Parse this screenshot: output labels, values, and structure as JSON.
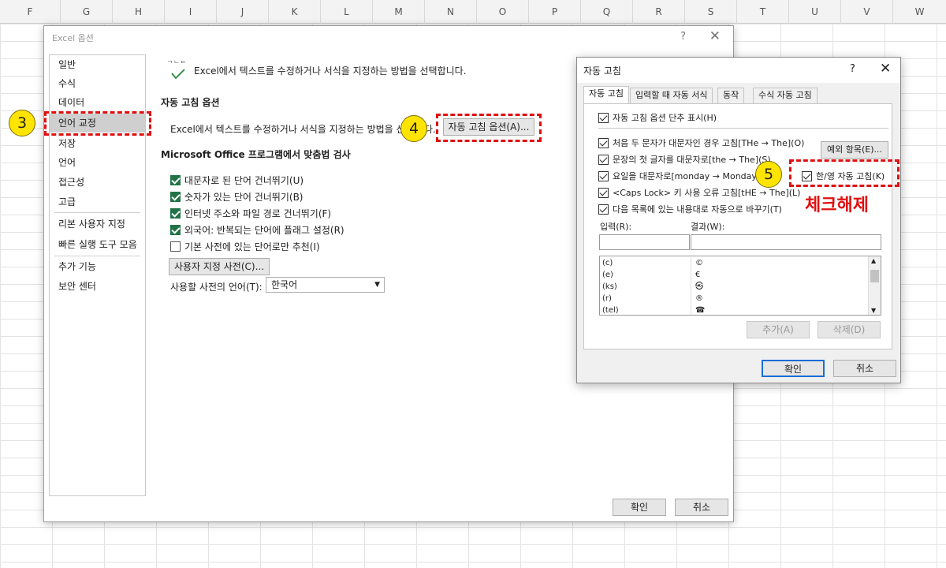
{
  "sheet": {
    "columns": [
      "F",
      "G",
      "H",
      "I",
      "J",
      "K",
      "L",
      "M",
      "N",
      "O",
      "P",
      "Q",
      "R",
      "S",
      "T",
      "U",
      "V",
      "W"
    ]
  },
  "options_window": {
    "title": "Excel 옵션",
    "help_label": "?",
    "close_label": "✕",
    "nav_items": [
      "일반",
      "수식",
      "데이터",
      "언어 교정",
      "저장",
      "언어",
      "접근성",
      "고급",
      "리본 사용자 지정",
      "빠른 실행 도구 모음",
      "추가 기능",
      "보안 센터"
    ],
    "selected_nav": "언어 교정",
    "header_icon_text": "ᄀᄂᄃ",
    "header_text": "Excel에서 텍스트를 수정하거나 서식을 지정하는 방법을 선택합니다.",
    "autocorrect_section": {
      "title": "자동 고침 옵션",
      "description": "Excel에서 텍스트를 수정하거나 서식을 지정하는 방법을 선",
      "description_tail": "다.",
      "button_label": "자동 고침 옵션(A)..."
    },
    "spelling_section": {
      "title": "Microsoft Office 프로그램에서 맞춤법 검사",
      "checks": [
        {
          "label": "대문자로 된 단어 건너뛰기(U)",
          "checked": true
        },
        {
          "label": "숫자가 있는 단어 건너뛰기(B)",
          "checked": true
        },
        {
          "label": "인터넷 주소와 파일 경로 건너뛰기(F)",
          "checked": true
        },
        {
          "label": "외국어: 반복되는 단어에 플래그 설정(R)",
          "checked": true
        },
        {
          "label": "기본 사전에 있는 단어로만 추천(I)",
          "checked": false
        }
      ],
      "custom_dict_button": "사용자 지정 사전(C)...",
      "dict_language_label": "사용할 사전의 언어(T):",
      "dict_language_value": "한국어"
    },
    "ok_label": "확인",
    "cancel_label": "취소"
  },
  "autocorrect_dialog": {
    "title": "자동 고침",
    "help_label": "?",
    "close_label": "✕",
    "tabs": [
      "자동 고침",
      "입력할 때 자동 서식",
      "동작",
      "수식 자동 고침"
    ],
    "active_tab": "자동 고침",
    "show_buttons_label": "자동 고침 옵션 단추 표시(H)",
    "options": [
      {
        "label": "처음 두 문자가 대문자인 경우 고침[THe → The](O)",
        "checked": true
      },
      {
        "label": "문장의 첫 글자를 대문자로[the → The](S)",
        "checked": true
      },
      {
        "label": "요일을 대문자로[monday → Monday](N)",
        "checked": true
      },
      {
        "label": "<Caps Lock> 키 사용 오류 고침[tHE → The](L)",
        "checked": true
      }
    ],
    "exceptions_button": "예외 항목(E)...",
    "han_eng_label": "한/영 자동 고침(K)",
    "replace_label": "다음 목록에 있는 내용대로 자동으로 바꾸기(T)",
    "input_label": "입력(R):",
    "result_label": "결과(W):",
    "list": [
      {
        "input": "(c)",
        "result": "©"
      },
      {
        "input": "(e)",
        "result": "€"
      },
      {
        "input": "(ks)",
        "result": "㉿"
      },
      {
        "input": "(r)",
        "result": "®"
      },
      {
        "input": "(tel)",
        "result": "☎"
      }
    ],
    "add_label": "추가(A)",
    "delete_label": "삭제(D)",
    "ok_label": "확인",
    "cancel_label": "취소"
  },
  "annotations": {
    "step3": "3",
    "step4": "4",
    "step5": "5",
    "uncheck_text": "체크해제"
  }
}
